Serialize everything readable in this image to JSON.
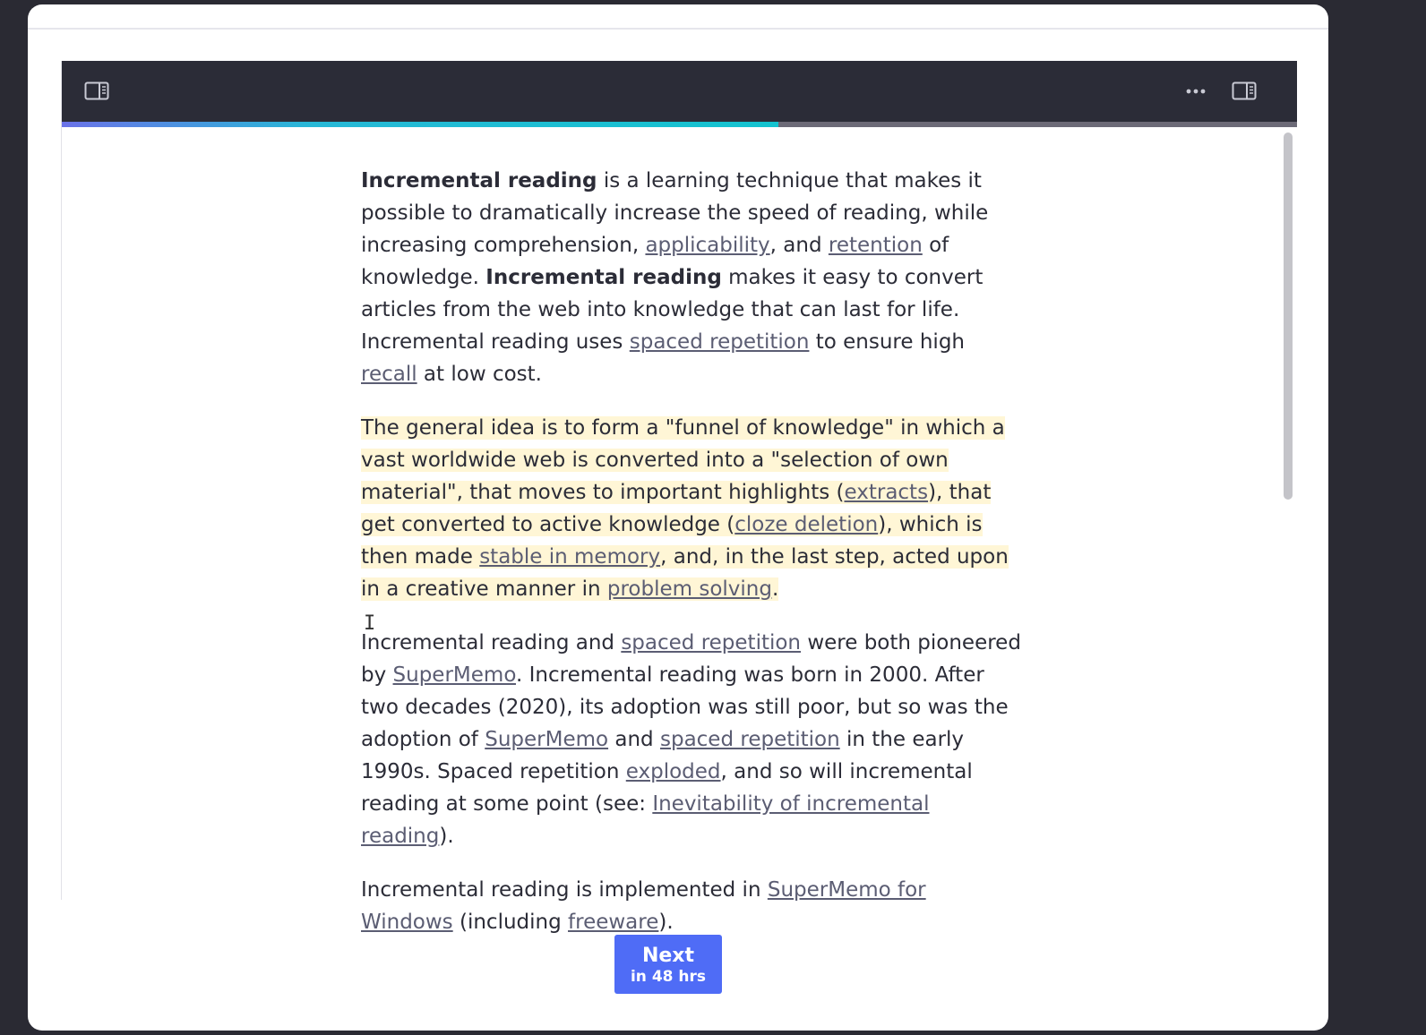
{
  "reader": {
    "progress_fraction": 0.58,
    "toolbar": {
      "left_icon": "sidebar-left-icon",
      "more_icon": "more-horizontal-icon",
      "right_icon": "sidebar-right-icon"
    },
    "paragraphs": [
      {
        "highlighted": false,
        "segments": [
          {
            "t": "Incremental reading",
            "b": true
          },
          {
            "t": " is a learning technique that makes it possible to dramatically increase the speed of reading, while increasing comprehension, "
          },
          {
            "t": "applicability",
            "link": true
          },
          {
            "t": ", and "
          },
          {
            "t": "retention",
            "link": true
          },
          {
            "t": " of knowledge. "
          },
          {
            "t": "Incremental reading",
            "b": true
          },
          {
            "t": " makes it easy to convert articles from the web into knowledge that can last for life. Incremental reading uses "
          },
          {
            "t": "spaced repetition",
            "link": true
          },
          {
            "t": " to ensure high "
          },
          {
            "t": "recall",
            "link": true
          },
          {
            "t": " at low cost."
          }
        ]
      },
      {
        "highlighted": true,
        "segments": [
          {
            "t": "The general idea is to form a \"funnel of knowledge\" in which a vast worldwide web is converted into a \"selection of own material\", that moves to important highlights ("
          },
          {
            "t": "extracts",
            "link": true
          },
          {
            "t": "), that get converted to active knowledge ("
          },
          {
            "t": "cloze deletion",
            "link": true
          },
          {
            "t": "), which is then made "
          },
          {
            "t": "stable in memory",
            "link": true
          },
          {
            "t": ", and, in the last step, acted upon in a creative manner in "
          },
          {
            "t": "problem solving",
            "link": true
          },
          {
            "t": "."
          }
        ]
      },
      {
        "highlighted": false,
        "segments": [
          {
            "t": "Incremental reading and "
          },
          {
            "t": "spaced repetition",
            "link": true
          },
          {
            "t": " were both pioneered by "
          },
          {
            "t": "SuperMemo",
            "link": true
          },
          {
            "t": ". Incremental reading was born in 2000. After two decades (2020), its adoption was still poor, but so was the adoption of "
          },
          {
            "t": "SuperMemo",
            "link": true
          },
          {
            "t": " and "
          },
          {
            "t": "spaced repetition",
            "link": true
          },
          {
            "t": " in the early 1990s. Spaced repetition "
          },
          {
            "t": "exploded",
            "link": true
          },
          {
            "t": ", and so will incremental reading at some point (see: "
          },
          {
            "t": "Inevitability of incremental reading",
            "link": true
          },
          {
            "t": ")."
          }
        ]
      },
      {
        "highlighted": false,
        "segments": [
          {
            "t": "Incremental reading is implemented in "
          },
          {
            "t": "SuperMemo for Windows",
            "link": true
          },
          {
            "t": " (including "
          },
          {
            "t": "freeware",
            "link": true
          },
          {
            "t": ")."
          }
        ]
      }
    ]
  },
  "next_button": {
    "label": "Next",
    "sublabel": "in 48 hrs"
  },
  "colors": {
    "toolbar_bg": "#2b2c37",
    "page_bg": "#2a2a33",
    "highlight": "#fff6d6",
    "link": "#5b5d73",
    "button": "#4f6cf6"
  }
}
